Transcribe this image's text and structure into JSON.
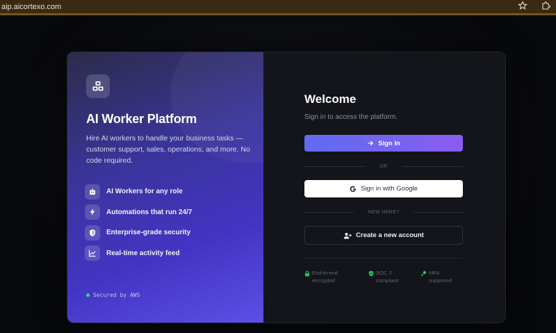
{
  "browser": {
    "url": "aip.aicortexo.com",
    "bookmark_icon": "star-icon",
    "extensions_icon": "puzzle-icon"
  },
  "brand": {
    "logo_icon": "cubes-icon",
    "title": "AI Worker Platform",
    "description": "Hire AI workers to handle your business tasks — customer support, sales, operations, and more. No code required.",
    "features": [
      {
        "icon": "robot-icon",
        "label": "AI Workers for any role"
      },
      {
        "icon": "bolt-icon",
        "label": "Automations that run 24/7"
      },
      {
        "icon": "shield-icon",
        "label": "Enterprise-grade security"
      },
      {
        "icon": "chart-icon",
        "label": "Real-time activity feed"
      }
    ],
    "footer": "Secured by AWS"
  },
  "auth": {
    "title": "Welcome",
    "subtitle": "Sign in to access the platform.",
    "sign_in_label": "Sign In",
    "or_label": "OR",
    "google_label": "Sign in with Google",
    "new_here_label": "NEW HERE?",
    "create_label": "Create a new account",
    "badges": [
      {
        "icon": "lock-icon",
        "line1": "End-to-end",
        "line2": "encrypted"
      },
      {
        "icon": "shield-check-icon",
        "line1": "SOC 2",
        "line2": "compliant"
      },
      {
        "icon": "key-icon",
        "line1": "MFA",
        "line2": "supported"
      }
    ]
  },
  "colors": {
    "accent_start": "#5f6cf0",
    "accent_end": "#8a5cf0",
    "badge_green": "#22c55e",
    "panel_dark": "#13151b"
  }
}
